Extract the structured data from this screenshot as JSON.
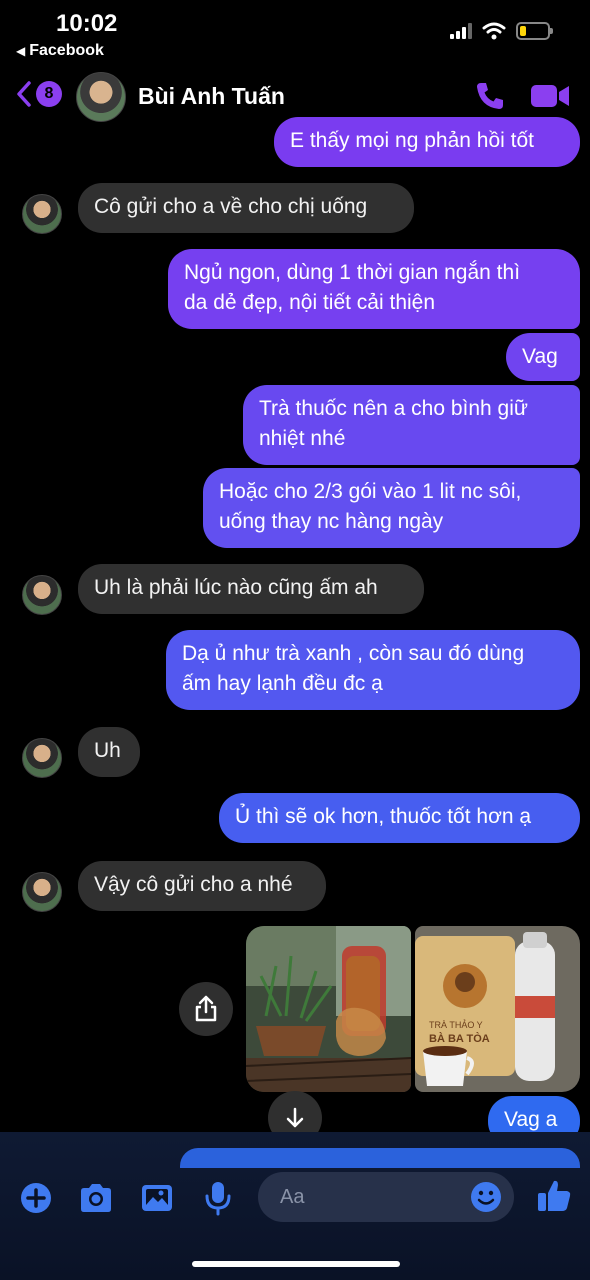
{
  "status": {
    "time": "10:02",
    "back_app": "Facebook"
  },
  "header": {
    "unread_count": "8",
    "contact_name": "Bùi Anh Tuấn"
  },
  "messages": [
    {
      "dir": "out",
      "text": "E thấy mọi ng phản hồi tốt"
    },
    {
      "dir": "in",
      "text": "Cô gửi cho a về cho chị uống"
    },
    {
      "dir": "out",
      "text": "Ngủ ngon, dùng 1 thời gian ngắn thì\nda dẻ đẹp, nội tiết cải thiện"
    },
    {
      "dir": "out",
      "text": "Vag"
    },
    {
      "dir": "out",
      "text": "Trà thuốc nên a cho bình giữ\nnhiệt nhé"
    },
    {
      "dir": "out",
      "text": "Hoặc cho 2/3 gói vào 1 lit nc sôi,\nuống thay nc hàng ngày"
    },
    {
      "dir": "in",
      "text": "Uh là phải lúc nào cũng ấm ah"
    },
    {
      "dir": "out",
      "text": "Dạ ủ như trà xanh , còn sau đó dùng\nấm hay lạnh đều đc ạ"
    },
    {
      "dir": "in",
      "text": "Uh"
    },
    {
      "dir": "out",
      "text": "Ủ thì sẽ ok hơn, thuốc tốt hơn ạ"
    },
    {
      "dir": "in",
      "text": "Vậy cô gửi cho a nhé"
    },
    {
      "dir": "out",
      "text": "Vag a"
    }
  ],
  "photos": {
    "left": "tea pot and potted plant on table",
    "right_label_1": "TRÀ THẢO Y",
    "right_label_2": "BÀ BA TÒA"
  },
  "composer": {
    "placeholder": "Aa"
  },
  "colors": {
    "accent": "#8b3ff0",
    "bubble_in": "#303030",
    "bubble_out_top": "#7d3cf0",
    "bubble_out_bottom": "#2f68f0"
  }
}
